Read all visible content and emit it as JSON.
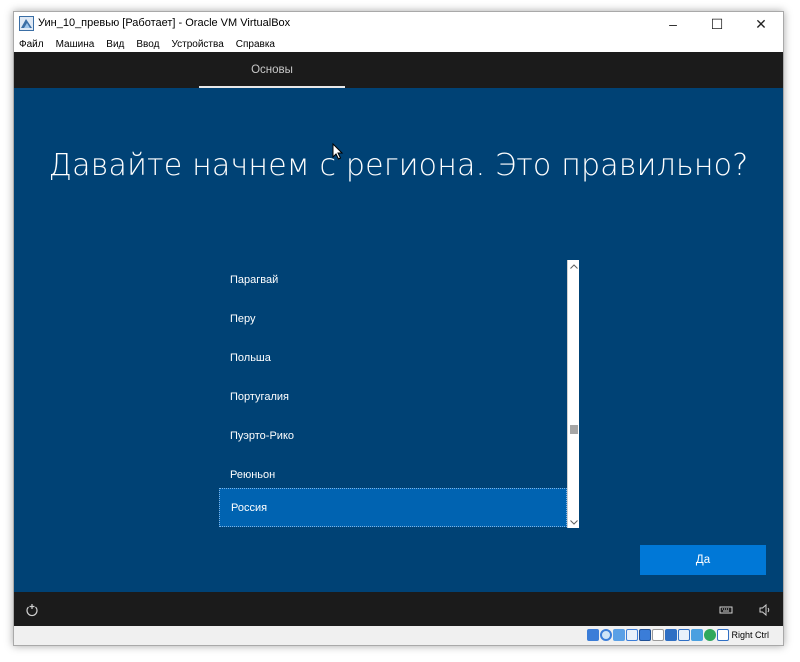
{
  "window": {
    "title": "Уин_10_превью [Работает] - Oracle VM VirtualBox",
    "app_icon": "virtualbox-logo-icon",
    "controls": {
      "minimize": "–",
      "maximize": "☐",
      "close": "✕"
    }
  },
  "menu": {
    "items": [
      {
        "label": "Файл"
      },
      {
        "label": "Машина"
      },
      {
        "label": "Вид"
      },
      {
        "label": "Ввод"
      },
      {
        "label": "Устройства"
      },
      {
        "label": "Справка"
      }
    ]
  },
  "oobe": {
    "tab": "Основы",
    "heading": "Давайте начнем с региона. Это правильно?",
    "regions": [
      {
        "label": "Парагвай"
      },
      {
        "label": "Перу"
      },
      {
        "label": "Польша"
      },
      {
        "label": "Португалия"
      },
      {
        "label": "Пуэрто-Рико"
      },
      {
        "label": "Реюньон"
      },
      {
        "label": "Россия",
        "selected": true
      }
    ],
    "selected_region": "Россия",
    "scroll_position_fraction": 0.65,
    "confirm_button": "Да",
    "footer_left_icon": "ease-of-access-icon",
    "footer_right_icons": [
      "keyboard-icon",
      "volume-icon"
    ]
  },
  "statusbar": {
    "icons": [
      "hard-disk-icon",
      "optical-drive-icon",
      "audio-icon",
      "network-icon",
      "usb-icon",
      "shared-folders-icon",
      "display-icon",
      "video-capture-icon",
      "cpu-icon",
      "mouse-integration-icon",
      "keyboard-capture-icon"
    ],
    "host_key": "Right Ctrl"
  },
  "colors": {
    "oobe_background": "#004275",
    "oobe_bar": "#1b1b1b",
    "selected_item": "#0063b1",
    "confirm_button": "#0078d7"
  }
}
